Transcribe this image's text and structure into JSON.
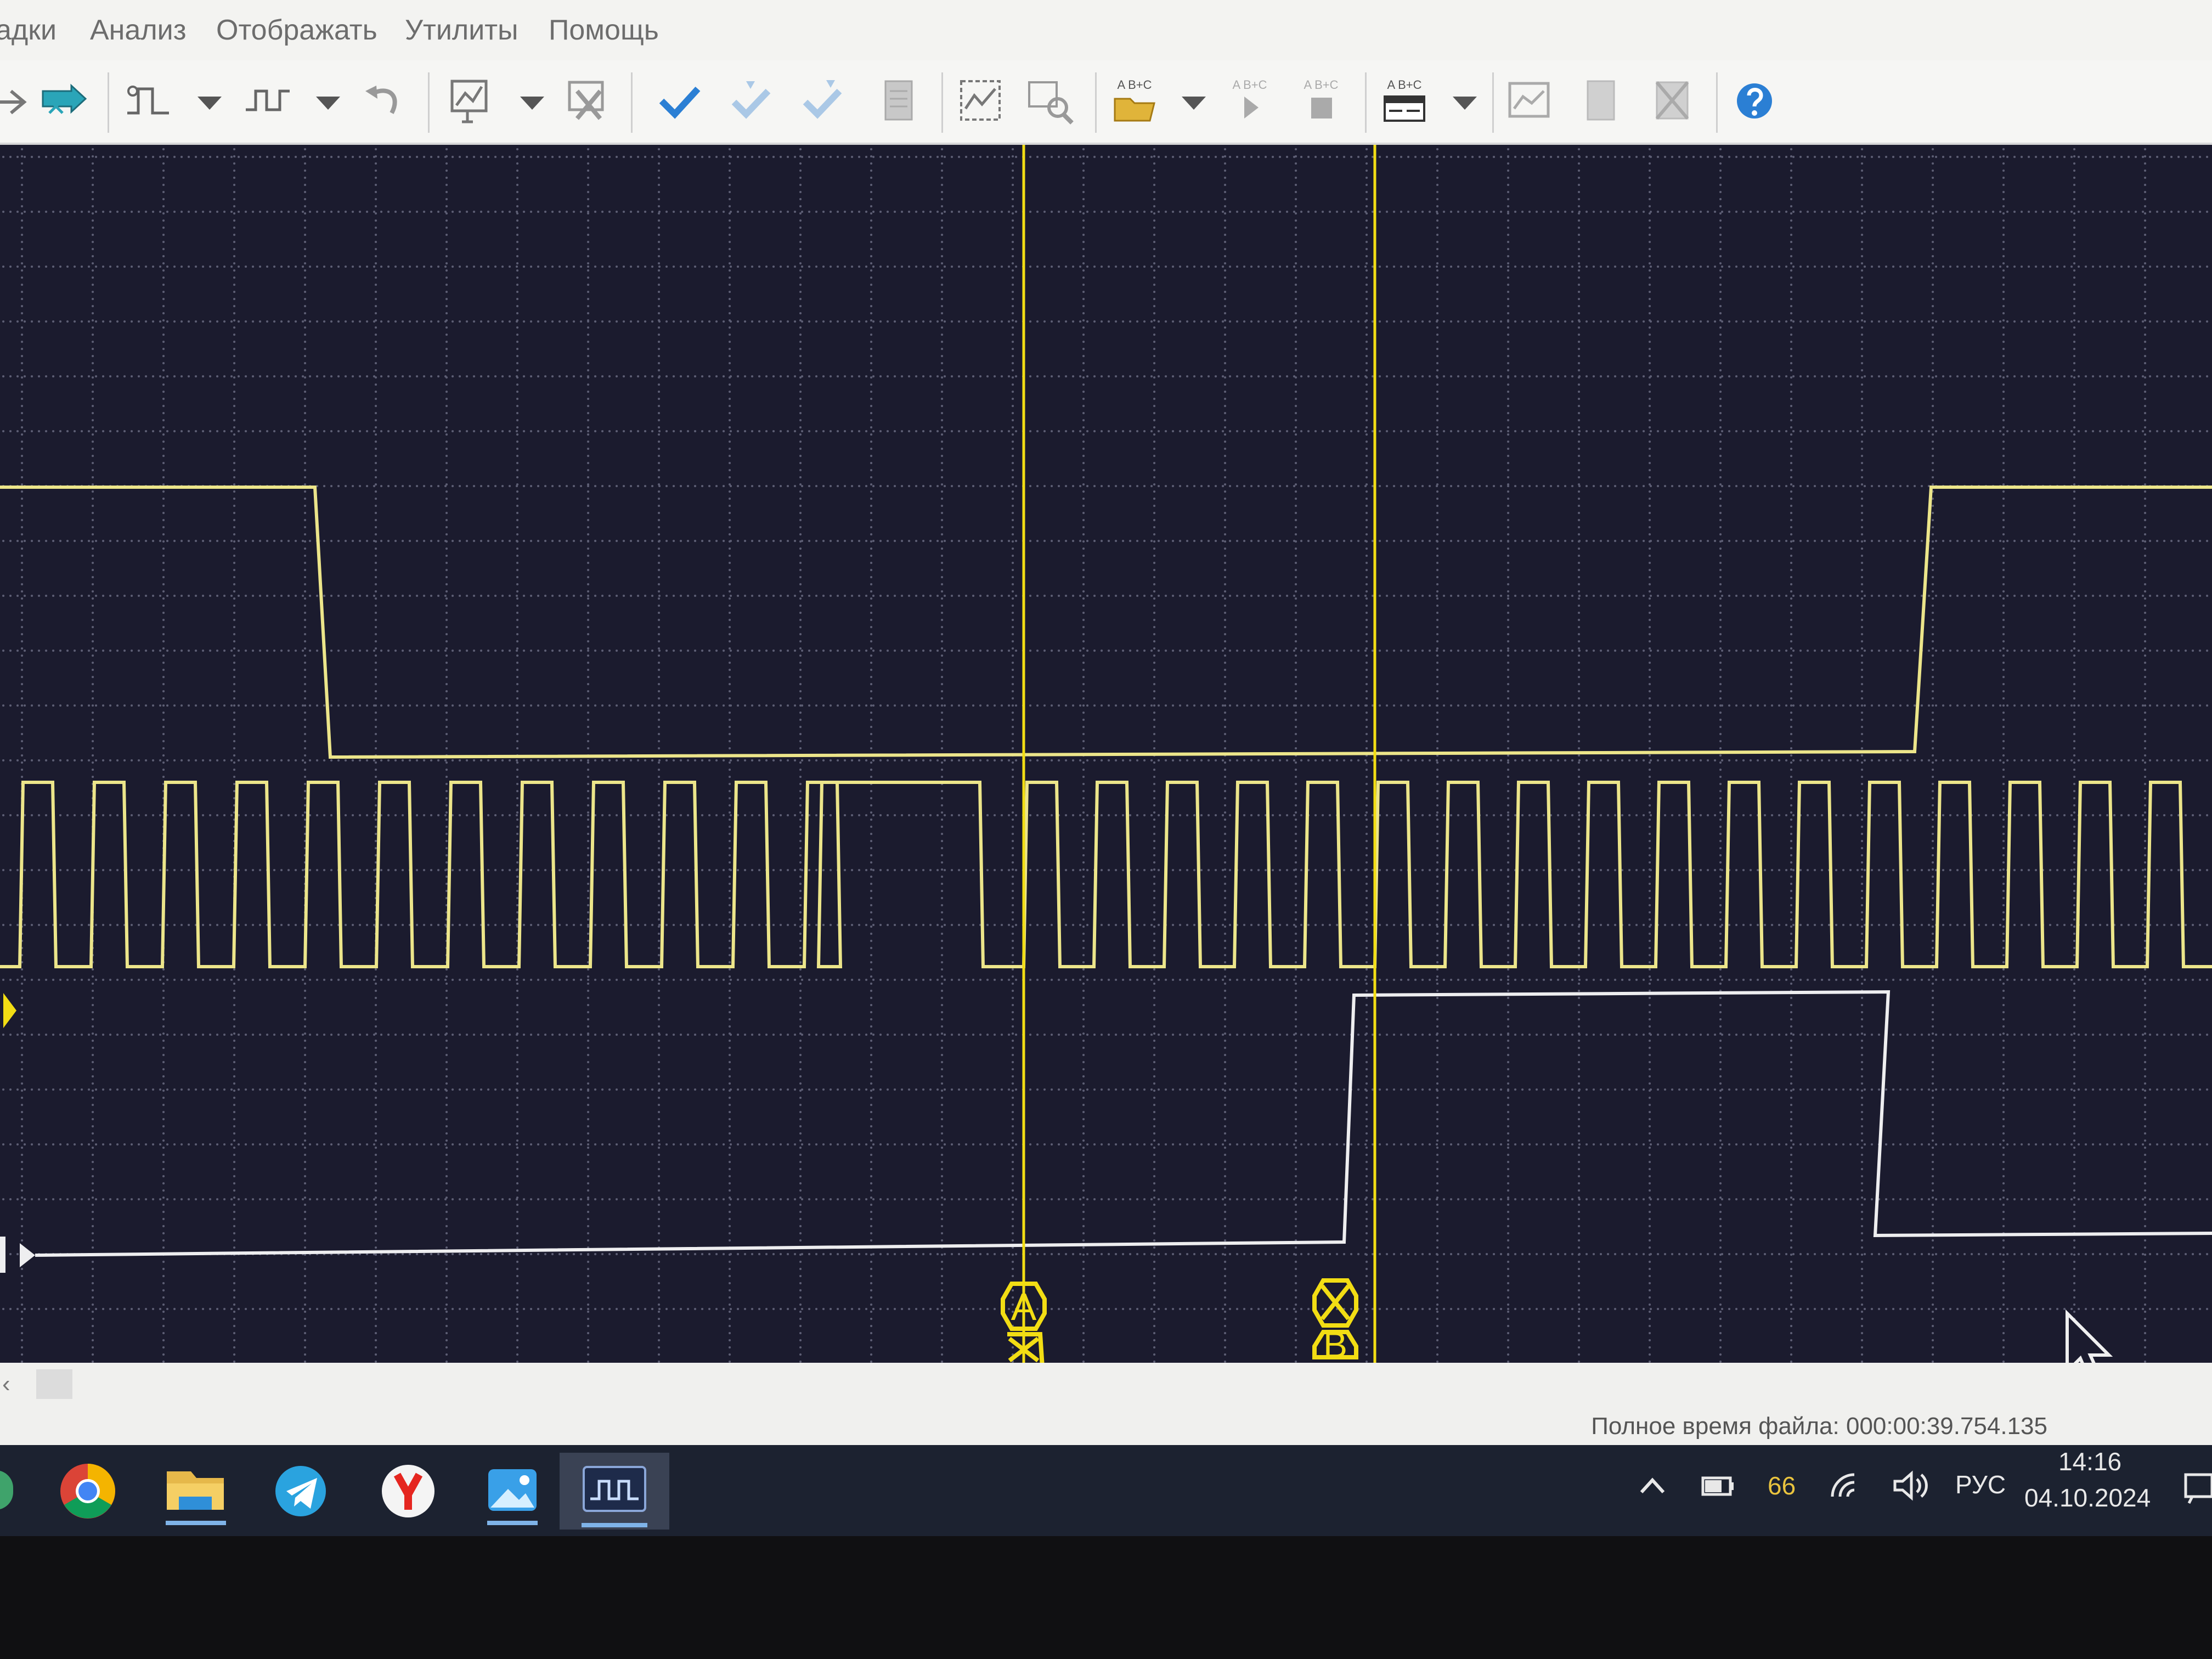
{
  "menu": {
    "items": [
      {
        "label": "адки"
      },
      {
        "label": "Анализ"
      },
      {
        "label": "Отображать"
      },
      {
        "label": "Утилиты"
      },
      {
        "label": "Помощь"
      }
    ]
  },
  "toolbar": {
    "text_tool_label": "A B+C"
  },
  "markers": {
    "a_label": "A",
    "b_label": "B"
  },
  "status": {
    "file_time": "Полное время файла: 000:00:39.754.135"
  },
  "taskbar": {
    "apps": [
      "chrome-icon",
      "folder-icon",
      "telegram-icon",
      "yandex-browser-icon",
      "photos-icon",
      "logic-analyzer-icon"
    ]
  },
  "tray": {
    "battery_value": "66",
    "language": "РУС",
    "time": "14:16",
    "date": "04.10.2024"
  },
  "colors": {
    "trace_yellow": "#ece58a",
    "marker_yellow": "#f2dd14",
    "trace_white": "#eeeef0",
    "grid_dot": "#5d5e74",
    "toolbar_blue": "#2b7fd4",
    "plot_background": "#1b1b2e"
  },
  "icons": {
    "menu_fragment": "dropdown-arrow-icon",
    "signals": "signal-icon",
    "cursor": "mouse-pointer-icon",
    "help": "help-icon"
  }
}
